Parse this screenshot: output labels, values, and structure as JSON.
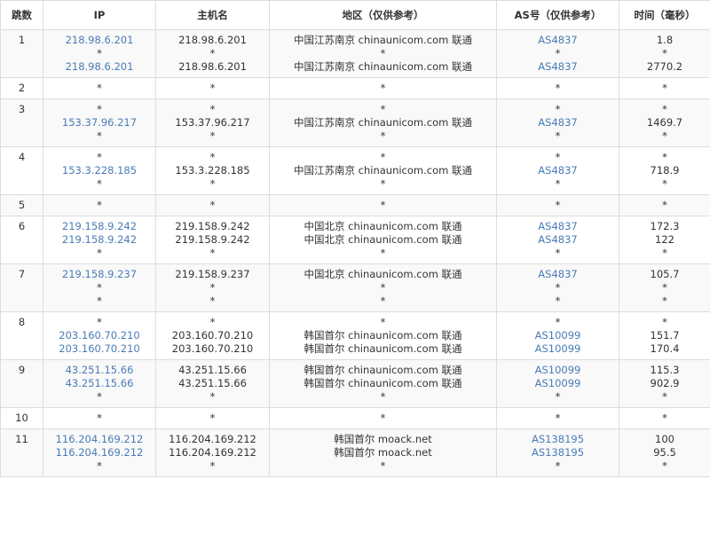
{
  "headers": {
    "hop": "跳数",
    "ip": "IP",
    "host": "主机名",
    "region": "地区（仅供参考）",
    "as": "AS号（仅供参考）",
    "time": "时间（毫秒）"
  },
  "hops": [
    {
      "hop": "1",
      "ip": [
        "218.98.6.201",
        "*",
        "218.98.6.201"
      ],
      "host": [
        "218.98.6.201",
        "*",
        "218.98.6.201"
      ],
      "region": [
        "中国江苏南京 chinaunicom.com 联通",
        "*",
        "中国江苏南京 chinaunicom.com 联通"
      ],
      "as": [
        "AS4837",
        "*",
        "AS4837"
      ],
      "time": [
        "1.8",
        "*",
        "2770.2"
      ]
    },
    {
      "hop": "2",
      "ip": [
        "*"
      ],
      "host": [
        "*"
      ],
      "region": [
        "*"
      ],
      "as": [
        "*"
      ],
      "time": [
        "*"
      ]
    },
    {
      "hop": "3",
      "ip": [
        "*",
        "153.37.96.217",
        "*"
      ],
      "host": [
        "*",
        "153.37.96.217",
        "*"
      ],
      "region": [
        "*",
        "中国江苏南京 chinaunicom.com 联通",
        "*"
      ],
      "as": [
        "*",
        "AS4837",
        "*"
      ],
      "time": [
        "*",
        "1469.7",
        "*"
      ]
    },
    {
      "hop": "4",
      "ip": [
        "*",
        "153.3.228.185",
        "*"
      ],
      "host": [
        "*",
        "153.3.228.185",
        "*"
      ],
      "region": [
        "*",
        "中国江苏南京 chinaunicom.com 联通",
        "*"
      ],
      "as": [
        "*",
        "AS4837",
        "*"
      ],
      "time": [
        "*",
        "718.9",
        "*"
      ]
    },
    {
      "hop": "5",
      "ip": [
        "*"
      ],
      "host": [
        "*"
      ],
      "region": [
        "*"
      ],
      "as": [
        "*"
      ],
      "time": [
        "*"
      ]
    },
    {
      "hop": "6",
      "ip": [
        "219.158.9.242",
        "219.158.9.242",
        "*"
      ],
      "host": [
        "219.158.9.242",
        "219.158.9.242",
        "*"
      ],
      "region": [
        "中国北京 chinaunicom.com 联通",
        "中国北京 chinaunicom.com 联通",
        "*"
      ],
      "as": [
        "AS4837",
        "AS4837",
        "*"
      ],
      "time": [
        "172.3",
        "122",
        "*"
      ]
    },
    {
      "hop": "7",
      "ip": [
        "219.158.9.237",
        "*",
        "*"
      ],
      "host": [
        "219.158.9.237",
        "*",
        "*"
      ],
      "region": [
        "中国北京 chinaunicom.com 联通",
        "*",
        "*"
      ],
      "as": [
        "AS4837",
        "*",
        "*"
      ],
      "time": [
        "105.7",
        "*",
        "*"
      ]
    },
    {
      "hop": "8",
      "ip": [
        "*",
        "203.160.70.210",
        "203.160.70.210"
      ],
      "host": [
        "*",
        "203.160.70.210",
        "203.160.70.210"
      ],
      "region": [
        "*",
        "韩国首尔 chinaunicom.com 联通",
        "韩国首尔 chinaunicom.com 联通"
      ],
      "as": [
        "*",
        "AS10099",
        "AS10099"
      ],
      "time": [
        "*",
        "151.7",
        "170.4"
      ]
    },
    {
      "hop": "9",
      "ip": [
        "43.251.15.66",
        "43.251.15.66",
        "*"
      ],
      "host": [
        "43.251.15.66",
        "43.251.15.66",
        "*"
      ],
      "region": [
        "韩国首尔 chinaunicom.com 联通",
        "韩国首尔 chinaunicom.com 联通",
        "*"
      ],
      "as": [
        "AS10099",
        "AS10099",
        "*"
      ],
      "time": [
        "115.3",
        "902.9",
        "*"
      ]
    },
    {
      "hop": "10",
      "ip": [
        "*"
      ],
      "host": [
        "*"
      ],
      "region": [
        "*"
      ],
      "as": [
        "*"
      ],
      "time": [
        "*"
      ]
    },
    {
      "hop": "11",
      "ip": [
        "116.204.169.212",
        "116.204.169.212",
        "*"
      ],
      "host": [
        "116.204.169.212",
        "116.204.169.212",
        "*"
      ],
      "region": [
        "韩国首尔 moack.net",
        "韩国首尔 moack.net",
        "*"
      ],
      "as": [
        "AS138195",
        "AS138195",
        "*"
      ],
      "time": [
        "100",
        "95.5",
        "*"
      ]
    }
  ],
  "colors": {
    "link": "#4a7bb7",
    "text": "#333333",
    "border": "#dcdcdc",
    "row_alt": "#f9f9f9"
  }
}
